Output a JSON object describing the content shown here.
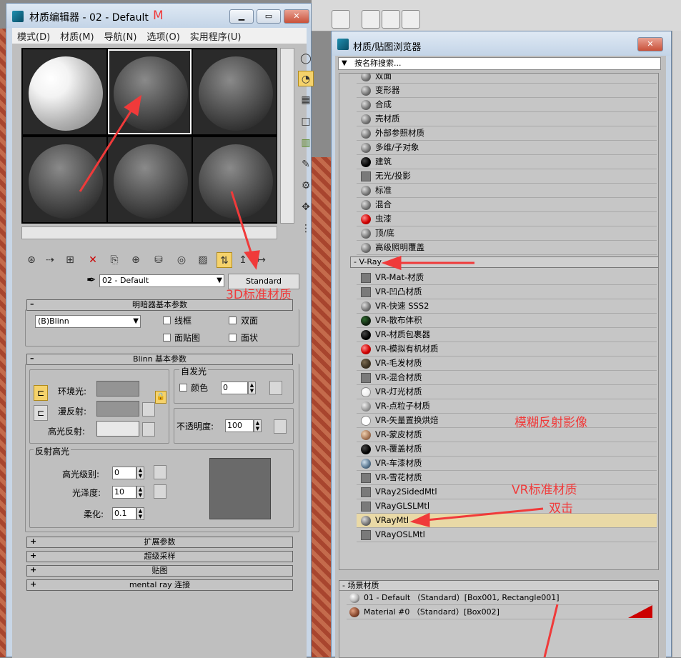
{
  "material_editor": {
    "title": "材质编辑器 - 02 - Default",
    "title_hotkey": "M",
    "menu": [
      "模式(D)",
      "材质(M)",
      "导航(N)",
      "选项(O)",
      "实用程序(U)"
    ],
    "material_name": "02 - Default",
    "material_type_button": "Standard",
    "shader_rollout": {
      "title": "明暗器基本参数",
      "shader": "(B)Blinn",
      "checkboxes": [
        "线框",
        "双面",
        "面贴图",
        "面状"
      ]
    },
    "blinn_rollout": {
      "title": "Blinn 基本参数",
      "self_illum": {
        "group_label": "自发光",
        "color_label": "颜色",
        "value": "0"
      },
      "labels": {
        "ambient": "环境光:",
        "diffuse": "漫反射:",
        "specular": "高光反射:"
      },
      "opacity": {
        "label": "不透明度:",
        "value": "100"
      },
      "specular_highlights": {
        "group_label": "反射高光",
        "level": {
          "label": "高光级别:",
          "value": "0"
        },
        "gloss": {
          "label": "光泽度:",
          "value": "10"
        },
        "soften": {
          "label": "柔化:",
          "value": "0.1"
        }
      }
    },
    "collapsed_rollouts": [
      "扩展参数",
      "超级采样",
      "贴图",
      "mental ray 连接"
    ]
  },
  "browser": {
    "title": "材质/贴图浏览器",
    "search_placeholder": "按名称搜索...",
    "standard_items": [
      {
        "label": "双面",
        "icon": "sphere"
      },
      {
        "label": "变形器",
        "icon": "sphere"
      },
      {
        "label": "合成",
        "icon": "sphere"
      },
      {
        "label": "壳材质",
        "icon": "sphere"
      },
      {
        "label": "外部参照材质",
        "icon": "sphere"
      },
      {
        "label": "多维/子对象",
        "icon": "sphere"
      },
      {
        "label": "建筑",
        "icon": "black"
      },
      {
        "label": "无光/投影",
        "icon": "square"
      },
      {
        "label": "标准",
        "icon": "sphere"
      },
      {
        "label": "混合",
        "icon": "sphere"
      },
      {
        "label": "虫漆",
        "icon": "red"
      },
      {
        "label": "顶/底",
        "icon": "sphere"
      },
      {
        "label": "高级照明覆盖",
        "icon": "sphere"
      }
    ],
    "vray_category": "- V-Ray",
    "vray_items": [
      {
        "label": "VR-Mat-材质",
        "icon": "square"
      },
      {
        "label": "VR-凹凸材质",
        "icon": "square"
      },
      {
        "label": "VR-快速 SSS2",
        "icon": "sphere"
      },
      {
        "label": "VR-散布体积",
        "icon": "scatter"
      },
      {
        "label": "VR-材质包裹器",
        "icon": "black"
      },
      {
        "label": "VR-模拟有机材质",
        "icon": "red"
      },
      {
        "label": "VR-毛发材质",
        "icon": "fur"
      },
      {
        "label": "VR-混合材质",
        "icon": "square"
      },
      {
        "label": "VR-灯光材质",
        "icon": "white"
      },
      {
        "label": "VR-点粒子材质",
        "icon": "point"
      },
      {
        "label": "VR-矢量置换烘焙",
        "icon": "outline"
      },
      {
        "label": "VR-蒙皮材质",
        "icon": "tan"
      },
      {
        "label": "VR-覆盖材质",
        "icon": "black"
      },
      {
        "label": "VR-车漆材质",
        "icon": "car"
      },
      {
        "label": "VR-雪花材质",
        "icon": "square"
      },
      {
        "label": "VRay2SidedMtl",
        "icon": "square"
      },
      {
        "label": "VRayGLSLMtl",
        "icon": "square"
      },
      {
        "label": "VRayMtl",
        "icon": "sphere"
      },
      {
        "label": "VRayOSLMtl",
        "icon": "square"
      }
    ],
    "scene_category": "- 场景材质",
    "scene_items": [
      "01 - Default （Standard）[Box001, Rectangle001]",
      "Material #0 （Standard）[Box002]"
    ]
  },
  "annotations": {
    "standard": "3D标准材质",
    "blur": "模糊反射影像",
    "vr_standard": "VR标准材质",
    "double_click": "双击"
  },
  "colors": {
    "annotation": "#f03a3a",
    "highlight_row": "#e9d9a6",
    "title_bar": "#c8d6e6"
  }
}
